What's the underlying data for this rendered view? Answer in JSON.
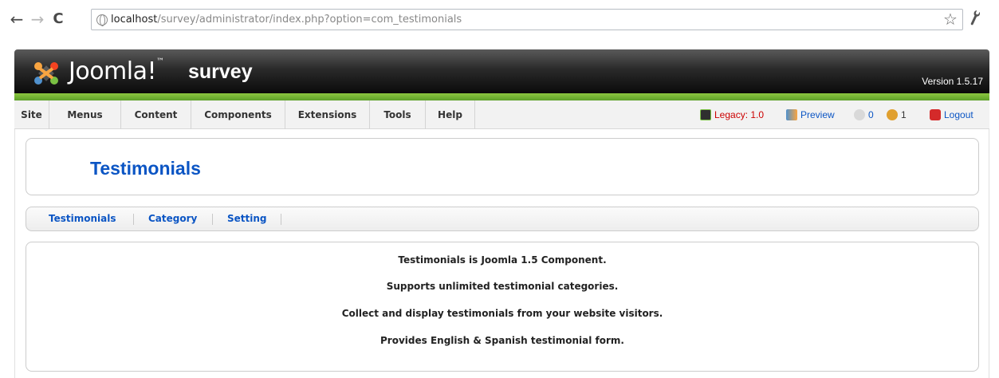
{
  "browser": {
    "url_host": "localhost",
    "url_path": "/survey/administrator/index.php?option=com_testimonials",
    "back_icon": "←",
    "forward_icon": "→",
    "reload_icon": "C",
    "star_icon": "☆",
    "wrench_icon": "🔧"
  },
  "header": {
    "logo_text": "Joomla!",
    "site_name": "survey",
    "version": "Version 1.5.17"
  },
  "menu": {
    "items": [
      "Site",
      "Menus",
      "Content",
      "Components",
      "Extensions",
      "Tools",
      "Help"
    ],
    "legacy": "Legacy: 1.0",
    "preview": "Preview",
    "messages_count": "0",
    "users_count": "1",
    "logout": "Logout"
  },
  "page": {
    "title": "Testimonials"
  },
  "submenu": {
    "items": [
      "Testimonials",
      "Category",
      "Setting"
    ]
  },
  "content": {
    "lines": [
      "Testimonials is Joomla 1.5 Component.",
      "Supports unlimited testimonial categories.",
      "Collect and display testimonials from your website visitors.",
      "Provides English & Spanish testimonial form."
    ]
  },
  "colors": {
    "link_blue": "#0b55c4",
    "brand_green": "#8cc63f",
    "header_black": "#0a0a0a"
  }
}
